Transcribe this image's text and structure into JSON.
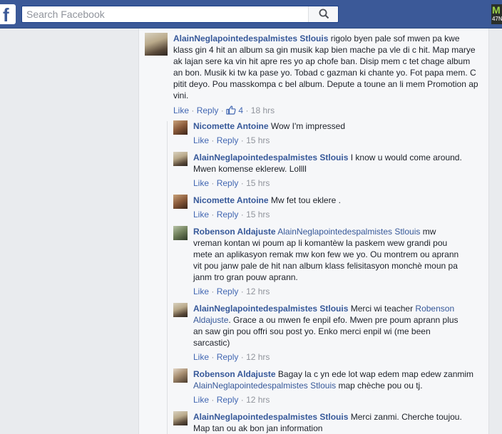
{
  "search": {
    "placeholder": "Search Facebook"
  },
  "corner": {
    "line1": "M",
    "line2": "47N"
  },
  "actions": {
    "like": "Like",
    "reply": "Reply",
    "sep": "·"
  },
  "comments": [
    {
      "author": "AlainNeglapointedespalmistes Stlouis",
      "text": " rigolo byen pale sof mwen pa kwe klass gin 4 hit an album sa gin musik kap bien mache pa vle di c hit. Map marye ak lajan sere ka vin hit apre res yo ap chofe ban. Disip mem c tet chage album an bon. Musik ki tw ka pase yo. Tobad c gazman ki chante yo. Fot papa mem. C pitit deyo. Pou masskompa c bel album. Depute a toune an li mem Promotion ap vini.",
      "likes": "4",
      "time": "18 hrs"
    },
    {
      "author": "Nicomette Antoine",
      "text": " Wow I'm impressed",
      "time": "15 hrs"
    },
    {
      "author": "AlainNeglapointedespalmistes Stlouis",
      "text": " I know u would come around. Mwen komense eklerew. Lollll",
      "time": "15 hrs"
    },
    {
      "author": "Nicomette Antoine",
      "text": " Mw fet tou eklere .",
      "time": "15 hrs"
    },
    {
      "author": "Robenson Aldajuste",
      "mention": "AlainNeglapointedespalmistes Stlouis",
      "text": " mw vreman kontan wi poum ap li komantèw la paskem wew grandi pou mete an aplikasyon remak mw kon few we yo. Ou montrem ou aprann vit pou janw pale de hit nan album klass felisitasyon monchè moun pa janm tro gran pouw aprann.",
      "time": "12 hrs"
    },
    {
      "author": "AlainNeglapointedespalmistes Stlouis",
      "text_before": " Merci wi teacher ",
      "mention": "Robenson Aldajuste",
      "text": ". Grace a ou mwen fe enpil efo. Mwen pre poum aprann plus an saw gin pou offri sou post yo. Enko merci enpil wi (me been sarcastic)",
      "time": "12 hrs"
    },
    {
      "author": "Robenson Aldajuste",
      "text_before": " Bagay la c yn ede lot wap edem map edew zanmim ",
      "mention": "AlainNeglapointedespalmistes Stlouis",
      "text": " map chèche pou ou tj.",
      "time": "12 hrs"
    },
    {
      "author": "AlainNeglapointedespalmistes Stlouis",
      "text": " Merci zanmi. Cherche toujou. Map tan ou ak bon jan information"
    }
  ],
  "colors": {
    "brand": "#3b5998",
    "link": "#365899",
    "action": "#4267b2",
    "meta": "#90949c"
  }
}
